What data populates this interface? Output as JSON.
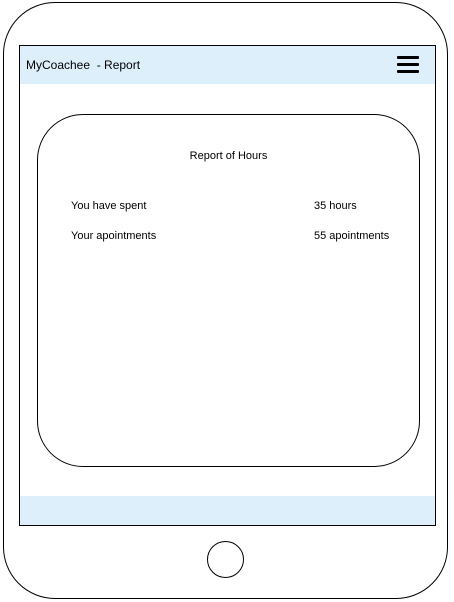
{
  "header": {
    "title": "MyCoachee  - Report",
    "menu_icon": "hamburger-menu-icon"
  },
  "report": {
    "title": "Report of Hours",
    "rows": [
      {
        "label": "You have spent",
        "value": "35 hours"
      },
      {
        "label": "Your apointments",
        "value": "55 apointments"
      }
    ]
  },
  "colors": {
    "header_bg": "#ddeffb",
    "footer_bg": "#ddeffb"
  }
}
